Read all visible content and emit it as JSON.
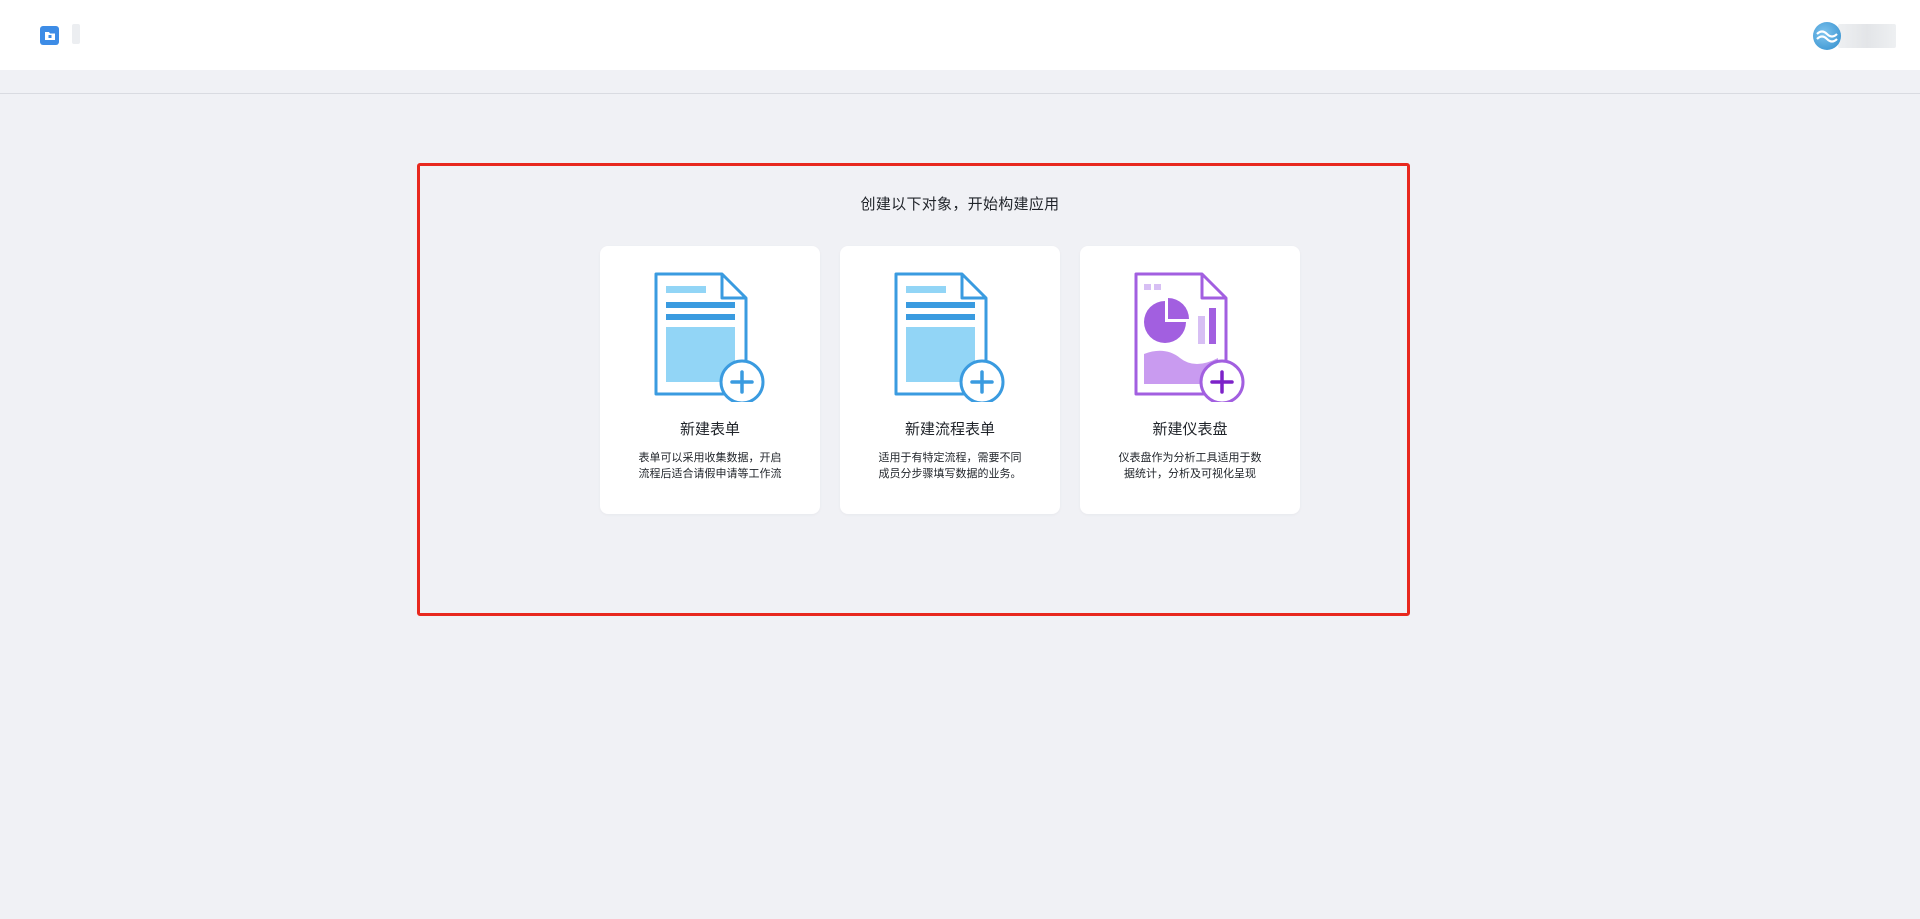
{
  "header": {
    "app_icon": "app-folder-icon",
    "user_avatar": "user-avatar-icon"
  },
  "main": {
    "prompt": "创建以下对象，开始构建应用",
    "cards": [
      {
        "title": "新建表单",
        "desc_line1": "表单可以采用收集数据，开启",
        "desc_line2": "流程后适合请假申请等工作流",
        "icon": "new-form-icon"
      },
      {
        "title": "新建流程表单",
        "desc_line1": "适用于有特定流程，需要不同",
        "desc_line2": "成员分步骤填写数据的业务。",
        "icon": "new-process-form-icon"
      },
      {
        "title": "新建仪表盘",
        "desc_line1": "仪表盘作为分析工具适用于数",
        "desc_line2": "据统计，分析及可视化呈现",
        "icon": "new-dashboard-icon"
      }
    ]
  },
  "colors": {
    "form_blue": "#3a9be0",
    "form_light": "#92d5f6",
    "dashboard_purple": "#a25fe0",
    "highlight_red": "#e8281e",
    "background": "#f0f1f5"
  }
}
